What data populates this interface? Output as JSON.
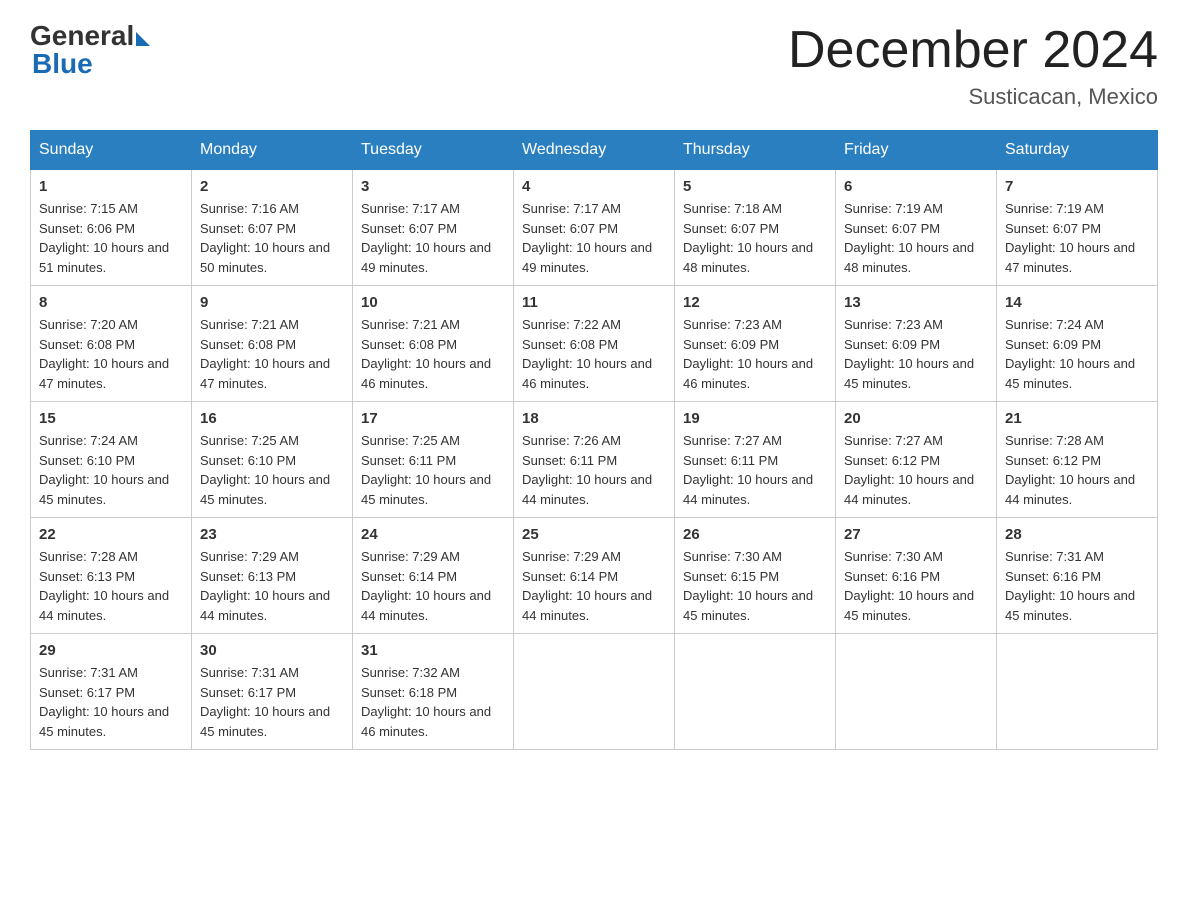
{
  "header": {
    "logo_general": "General",
    "logo_blue": "Blue",
    "month_title": "December 2024",
    "location": "Susticacan, Mexico"
  },
  "weekdays": [
    "Sunday",
    "Monday",
    "Tuesday",
    "Wednesday",
    "Thursday",
    "Friday",
    "Saturday"
  ],
  "weeks": [
    [
      {
        "day": "1",
        "sunrise": "7:15 AM",
        "sunset": "6:06 PM",
        "daylight": "10 hours and 51 minutes."
      },
      {
        "day": "2",
        "sunrise": "7:16 AM",
        "sunset": "6:07 PM",
        "daylight": "10 hours and 50 minutes."
      },
      {
        "day": "3",
        "sunrise": "7:17 AM",
        "sunset": "6:07 PM",
        "daylight": "10 hours and 49 minutes."
      },
      {
        "day": "4",
        "sunrise": "7:17 AM",
        "sunset": "6:07 PM",
        "daylight": "10 hours and 49 minutes."
      },
      {
        "day": "5",
        "sunrise": "7:18 AM",
        "sunset": "6:07 PM",
        "daylight": "10 hours and 48 minutes."
      },
      {
        "day": "6",
        "sunrise": "7:19 AM",
        "sunset": "6:07 PM",
        "daylight": "10 hours and 48 minutes."
      },
      {
        "day": "7",
        "sunrise": "7:19 AM",
        "sunset": "6:07 PM",
        "daylight": "10 hours and 47 minutes."
      }
    ],
    [
      {
        "day": "8",
        "sunrise": "7:20 AM",
        "sunset": "6:08 PM",
        "daylight": "10 hours and 47 minutes."
      },
      {
        "day": "9",
        "sunrise": "7:21 AM",
        "sunset": "6:08 PM",
        "daylight": "10 hours and 47 minutes."
      },
      {
        "day": "10",
        "sunrise": "7:21 AM",
        "sunset": "6:08 PM",
        "daylight": "10 hours and 46 minutes."
      },
      {
        "day": "11",
        "sunrise": "7:22 AM",
        "sunset": "6:08 PM",
        "daylight": "10 hours and 46 minutes."
      },
      {
        "day": "12",
        "sunrise": "7:23 AM",
        "sunset": "6:09 PM",
        "daylight": "10 hours and 46 minutes."
      },
      {
        "day": "13",
        "sunrise": "7:23 AM",
        "sunset": "6:09 PM",
        "daylight": "10 hours and 45 minutes."
      },
      {
        "day": "14",
        "sunrise": "7:24 AM",
        "sunset": "6:09 PM",
        "daylight": "10 hours and 45 minutes."
      }
    ],
    [
      {
        "day": "15",
        "sunrise": "7:24 AM",
        "sunset": "6:10 PM",
        "daylight": "10 hours and 45 minutes."
      },
      {
        "day": "16",
        "sunrise": "7:25 AM",
        "sunset": "6:10 PM",
        "daylight": "10 hours and 45 minutes."
      },
      {
        "day": "17",
        "sunrise": "7:25 AM",
        "sunset": "6:11 PM",
        "daylight": "10 hours and 45 minutes."
      },
      {
        "day": "18",
        "sunrise": "7:26 AM",
        "sunset": "6:11 PM",
        "daylight": "10 hours and 44 minutes."
      },
      {
        "day": "19",
        "sunrise": "7:27 AM",
        "sunset": "6:11 PM",
        "daylight": "10 hours and 44 minutes."
      },
      {
        "day": "20",
        "sunrise": "7:27 AM",
        "sunset": "6:12 PM",
        "daylight": "10 hours and 44 minutes."
      },
      {
        "day": "21",
        "sunrise": "7:28 AM",
        "sunset": "6:12 PM",
        "daylight": "10 hours and 44 minutes."
      }
    ],
    [
      {
        "day": "22",
        "sunrise": "7:28 AM",
        "sunset": "6:13 PM",
        "daylight": "10 hours and 44 minutes."
      },
      {
        "day": "23",
        "sunrise": "7:29 AM",
        "sunset": "6:13 PM",
        "daylight": "10 hours and 44 minutes."
      },
      {
        "day": "24",
        "sunrise": "7:29 AM",
        "sunset": "6:14 PM",
        "daylight": "10 hours and 44 minutes."
      },
      {
        "day": "25",
        "sunrise": "7:29 AM",
        "sunset": "6:14 PM",
        "daylight": "10 hours and 44 minutes."
      },
      {
        "day": "26",
        "sunrise": "7:30 AM",
        "sunset": "6:15 PM",
        "daylight": "10 hours and 45 minutes."
      },
      {
        "day": "27",
        "sunrise": "7:30 AM",
        "sunset": "6:16 PM",
        "daylight": "10 hours and 45 minutes."
      },
      {
        "day": "28",
        "sunrise": "7:31 AM",
        "sunset": "6:16 PM",
        "daylight": "10 hours and 45 minutes."
      }
    ],
    [
      {
        "day": "29",
        "sunrise": "7:31 AM",
        "sunset": "6:17 PM",
        "daylight": "10 hours and 45 minutes."
      },
      {
        "day": "30",
        "sunrise": "7:31 AM",
        "sunset": "6:17 PM",
        "daylight": "10 hours and 45 minutes."
      },
      {
        "day": "31",
        "sunrise": "7:32 AM",
        "sunset": "6:18 PM",
        "daylight": "10 hours and 46 minutes."
      },
      null,
      null,
      null,
      null
    ]
  ]
}
